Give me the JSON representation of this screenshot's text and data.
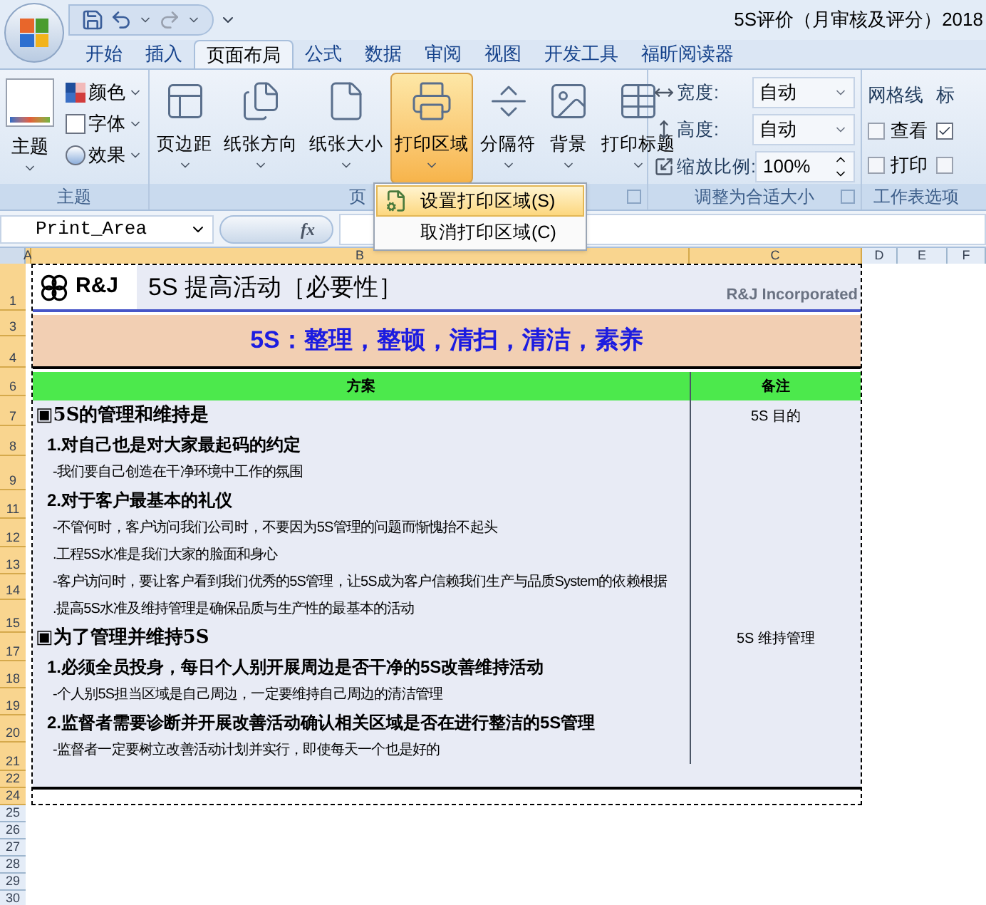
{
  "title_bar": {
    "title": "5S评价（月审核及评分）2018"
  },
  "tabs": [
    {
      "label": "开始",
      "selected": false
    },
    {
      "label": "插入",
      "selected": false
    },
    {
      "label": "页面布局",
      "selected": true
    },
    {
      "label": "公式",
      "selected": false
    },
    {
      "label": "数据",
      "selected": false
    },
    {
      "label": "审阅",
      "selected": false
    },
    {
      "label": "视图",
      "selected": false
    },
    {
      "label": "开发工具",
      "selected": false
    },
    {
      "label": "福昕阅读器",
      "selected": false
    }
  ],
  "ribbon_groups": [
    {
      "kind": "themes",
      "label": "主题",
      "buttons": [
        {
          "label": "主题"
        },
        {
          "label": "颜色"
        },
        {
          "label": "字体"
        },
        {
          "label": "效果"
        }
      ]
    },
    {
      "kind": "page_setup",
      "label": "页",
      "buttons": [
        {
          "label": "页边距",
          "selected": false
        },
        {
          "label": "纸张方向",
          "selected": false
        },
        {
          "label": "纸张大小",
          "selected": false
        },
        {
          "label": "打印区域",
          "selected": true
        },
        {
          "label": "分隔符",
          "selected": false
        },
        {
          "label": "背景",
          "selected": false
        },
        {
          "label": "打印标题",
          "selected": false
        }
      ]
    },
    {
      "kind": "fit",
      "label": "调整为合适大小",
      "fields": [
        {
          "label": "宽度:",
          "value": "自动"
        },
        {
          "label": "高度:",
          "value": "自动"
        },
        {
          "label": "缩放比例:",
          "value": "100%"
        }
      ]
    },
    {
      "kind": "sheet_options",
      "label": "工作表选项",
      "options": [
        {
          "heading": "网格线",
          "checks": [
            {
              "label": "查看",
              "checked": false
            },
            {
              "label": "打印",
              "checked": false
            }
          ]
        },
        {
          "heading": "标",
          "checks": [
            {
              "checked": true
            },
            {
              "checked": false
            }
          ]
        }
      ]
    }
  ],
  "print_area_menu": [
    {
      "label": "设置打印区域(S)",
      "selected": true
    },
    {
      "label": "取消打印区域(C)",
      "selected": false
    }
  ],
  "formula_bar": {
    "name_box": "Print_Area",
    "fx": "fx"
  },
  "column_headers": [
    {
      "label": "A",
      "selected": true
    },
    {
      "label": "B",
      "selected": true
    },
    {
      "label": "C",
      "selected": true
    },
    {
      "label": "D",
      "selected": false
    },
    {
      "label": "E",
      "selected": false
    },
    {
      "label": "F",
      "selected": false
    }
  ],
  "row_headers": [
    {
      "label": "1",
      "selected": true
    },
    {
      "label": "3",
      "selected": true
    },
    {
      "label": "4",
      "selected": true
    },
    {
      "label": "6",
      "selected": true
    },
    {
      "label": "7",
      "selected": true
    },
    {
      "label": "8",
      "selected": true
    },
    {
      "label": "9",
      "selected": true
    },
    {
      "label": "11",
      "selected": true
    },
    {
      "label": "12",
      "selected": true
    },
    {
      "label": "13",
      "selected": true
    },
    {
      "label": "14",
      "selected": true
    },
    {
      "label": "15",
      "selected": true
    },
    {
      "label": "17",
      "selected": true
    },
    {
      "label": "18",
      "selected": true
    },
    {
      "label": "19",
      "selected": true
    },
    {
      "label": "20",
      "selected": true
    },
    {
      "label": "21",
      "selected": true
    },
    {
      "label": "22",
      "selected": true
    },
    {
      "label": "24",
      "selected": true
    },
    {
      "label": "25",
      "selected": false
    },
    {
      "label": "26",
      "selected": false
    },
    {
      "label": "27",
      "selected": false
    },
    {
      "label": "28",
      "selected": false
    },
    {
      "label": "29",
      "selected": false
    },
    {
      "label": "30",
      "selected": false
    }
  ],
  "sheet": {
    "logo": "R&J",
    "title": "5S 提高活动［必要性］",
    "company": "R&J Incorporated",
    "banner": "5S：整理，整顿，清扫，清洁，素养",
    "columns": [
      "方案",
      "备注"
    ],
    "sections": [
      {
        "heading": "▣5S的管理和维持是",
        "note": "5S 目的",
        "lines": [
          {
            "kind": "point",
            "text": "1.对自己也是对大家最起码的约定"
          },
          {
            "kind": "detail",
            "text": "-我们要自己创造在干净环境中工作的氛围"
          },
          {
            "kind": "point",
            "text": "2.对于客户最基本的礼仪"
          },
          {
            "kind": "detail",
            "text": "-不管何时，客户访问我们公司时，不要因为5S管理的问题而惭愧抬不起头"
          },
          {
            "kind": "detail",
            "text": ".工程5S水准是我们大家的脸面和身心"
          },
          {
            "kind": "detail",
            "text": "-客户访问时，要让客户看到我们优秀的5S管理，让5S成为客户信赖我们生产与品质System的依赖根据"
          },
          {
            "kind": "detail",
            "text": ".提高5S水准及维持管理是确保品质与生产性的最基本的活动"
          }
        ]
      },
      {
        "heading": "▣为了管理并维持5S",
        "note": "5S 维持管理",
        "lines": [
          {
            "kind": "point",
            "text": "1.必须全员投身，每日个人别开展周边是否干净的5S改善维持活动"
          },
          {
            "kind": "detail",
            "text": "-个人别5S担当区域是自己周边，一定要维持自己周边的清洁管理"
          },
          {
            "kind": "point",
            "text": "2.监督者需要诊断并开展改善活动确认相关区域是否在进行整洁的5S管理"
          },
          {
            "kind": "detail",
            "text": "-监督者一定要树立改善活动计划并实行，即使每天一个也是好的"
          }
        ]
      }
    ]
  }
}
